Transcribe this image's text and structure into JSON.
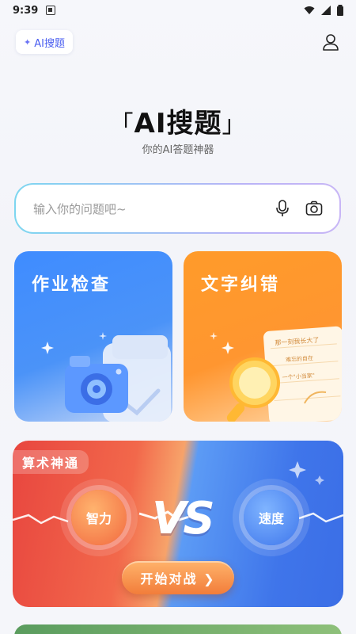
{
  "status": {
    "time": "9:39"
  },
  "topbar": {
    "chip_label": "AI搜题"
  },
  "hero": {
    "title": "AI搜题",
    "subtitle": "你的AI答题神器"
  },
  "search": {
    "placeholder": "输入你的问题吧~"
  },
  "cards": [
    {
      "title": "作业检查",
      "accent": "#3f8cff"
    },
    {
      "title": "文字纠错",
      "accent": "#ff9b2a"
    }
  ],
  "card_orange_paper_lines": [
    "那一刻我长大了",
    "难忘的自在",
    "一个\"小当家\""
  ],
  "banner": {
    "tag": "算术神通",
    "left_circle": "智力",
    "vs": "VS",
    "right_circle": "速度",
    "start_label": "开始对战 ❯"
  },
  "colors": {
    "brand": "#4a5ef0",
    "red": "#e8463f",
    "blue": "#3f75ea"
  }
}
